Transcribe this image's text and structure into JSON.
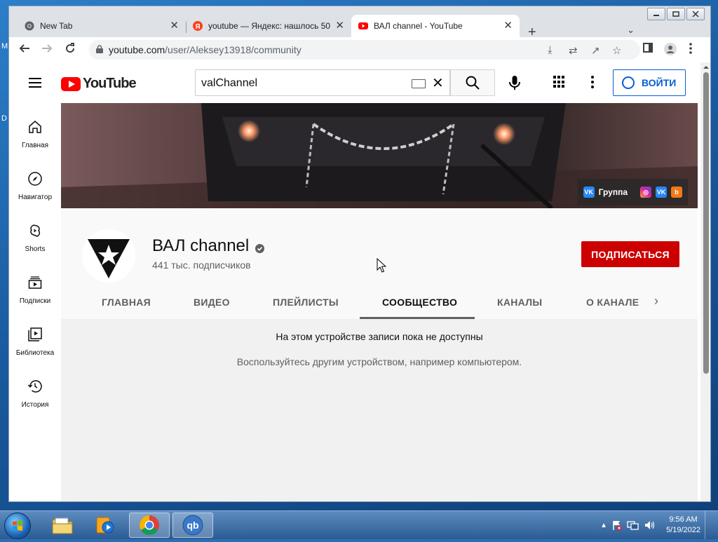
{
  "browser": {
    "tabs": [
      {
        "title": "New Tab",
        "favicon": "chrome-icon"
      },
      {
        "title": "youtube — Яндекс: нашлось 50",
        "favicon": "yandex-icon"
      },
      {
        "title": "ВАЛ channel - YouTube",
        "favicon": "youtube-icon",
        "active": true
      }
    ],
    "url_host": "youtube.com",
    "url_path": "/user/Aleksey13918/community"
  },
  "youtube": {
    "logo_text": "YouTube",
    "search_value": "valChannel",
    "signin_label": "ВОЙТИ",
    "guide": [
      {
        "label": "Главная",
        "icon": "home-icon"
      },
      {
        "label": "Навигатор",
        "icon": "compass-icon"
      },
      {
        "label": "Shorts",
        "icon": "shorts-icon"
      },
      {
        "label": "Подписки",
        "icon": "subscriptions-icon"
      },
      {
        "label": "Библиотека",
        "icon": "library-icon"
      },
      {
        "label": "История",
        "icon": "history-icon"
      }
    ],
    "banner_links": {
      "group_label": "Группа"
    },
    "channel": {
      "name": "ВАЛ channel",
      "subscribers": "441 тыс. подписчиков",
      "subscribe_label": "ПОДПИСАТЬСЯ"
    },
    "tabs": [
      "ГЛАВНАЯ",
      "ВИДЕО",
      "ПЛЕЙЛИСТЫ",
      "СООБЩЕСТВО",
      "КАНАЛЫ",
      "О КАНАЛЕ"
    ],
    "selected_tab": "СООБЩЕСТВО",
    "content": {
      "message_primary": "На этом устройстве записи пока не доступны",
      "message_secondary": "Воспользуйтесь другим устройством, например компьютером."
    }
  },
  "desktop": {
    "left_edge_letters": [
      "M",
      "D"
    ]
  },
  "taskbar": {
    "time": "9:56 AM",
    "date": "5/19/2022",
    "apps": [
      "file-explorer-icon",
      "media-player-icon",
      "chrome-icon",
      "qbittorrent-icon"
    ],
    "qb_label": "qb"
  },
  "colors": {
    "youtube_red": "#ff0000",
    "subscribe_red": "#cc0000",
    "signin_blue": "#065fd4"
  }
}
